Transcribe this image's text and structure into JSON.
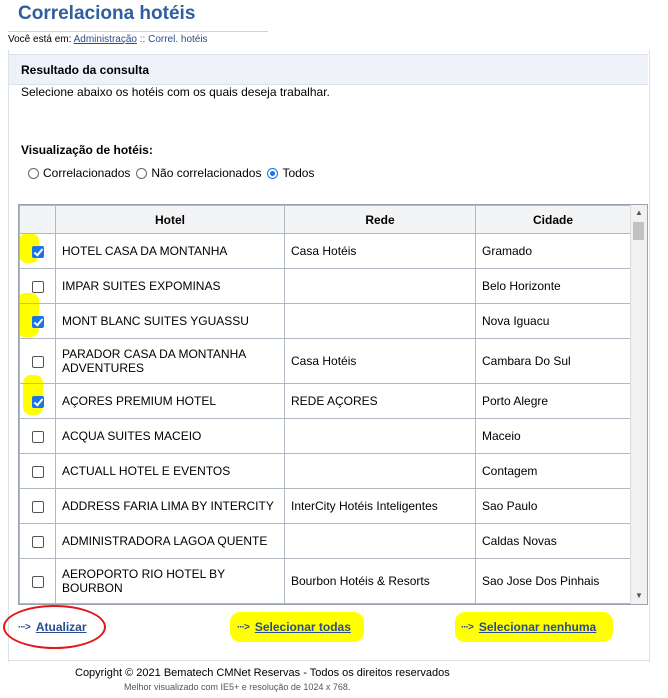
{
  "page": {
    "title": "Correlaciona hotéis",
    "breadcrumb_prefix": "Você está em:",
    "breadcrumb_link": "Administração",
    "breadcrumb_sep": "::",
    "breadcrumb_current": "Correl. hotéis"
  },
  "result": {
    "title": "Resultado da consulta",
    "description": "Selecione abaixo os hotéis com os quais deseja trabalhar."
  },
  "visualization": {
    "label": "Visualização de hotéis:",
    "options": [
      {
        "label": "Correlacionados",
        "selected": false
      },
      {
        "label": "Não correlacionados",
        "selected": false
      },
      {
        "label": "Todos",
        "selected": true
      }
    ]
  },
  "table": {
    "headers": [
      "Hotel",
      "Rede",
      "Cidade"
    ],
    "rows": [
      {
        "checked": true,
        "hotel": "HOTEL CASA DA MONTANHA",
        "rede": "Casa Hotéis",
        "cidade": "Gramado"
      },
      {
        "checked": false,
        "hotel": "IMPAR SUITES EXPOMINAS",
        "rede": "",
        "cidade": "Belo Horizonte"
      },
      {
        "checked": true,
        "hotel": "MONT BLANC SUITES YGUASSU",
        "rede": "",
        "cidade": "Nova Iguacu"
      },
      {
        "checked": false,
        "hotel": "PARADOR CASA DA MONTANHA ADVENTURES",
        "rede": "Casa Hotéis",
        "cidade": "Cambara Do Sul"
      },
      {
        "checked": true,
        "hotel": "AÇORES PREMIUM HOTEL",
        "rede": "REDE AÇORES",
        "cidade": "Porto Alegre"
      },
      {
        "checked": false,
        "hotel": "ACQUA SUITES MACEIO",
        "rede": "",
        "cidade": "Maceio"
      },
      {
        "checked": false,
        "hotel": "ACTUALL HOTEL E EVENTOS",
        "rede": "",
        "cidade": "Contagem"
      },
      {
        "checked": false,
        "hotel": "ADDRESS FARIA LIMA BY INTERCITY",
        "rede": "InterCity Hotéis Inteligentes",
        "cidade": "Sao Paulo"
      },
      {
        "checked": false,
        "hotel": "ADMINISTRADORA LAGOA QUENTE",
        "rede": "",
        "cidade": "Caldas Novas"
      },
      {
        "checked": false,
        "hotel": "AEROPORTO RIO HOTEL BY BOURBON",
        "rede": "Bourbon Hotéis & Resorts",
        "cidade": "Sao Jose Dos Pinhais"
      }
    ]
  },
  "actions": {
    "update": "Atualizar",
    "select_all": "Selecionar todas",
    "select_none": "Selecionar nenhuma"
  },
  "footer": {
    "copyright": "Copyright © 2021 Bematech CMNet Reservas - Todos os direitos reservados",
    "best_view": "Melhor visualizado com IE5+ e resolução de 1024 x 768."
  },
  "colors": {
    "title": "#2f5f9e",
    "link": "#2a4b8d",
    "checkbox_checked": "#1a73e8",
    "highlight": "#ffff00",
    "annotation_circle": "#e01818"
  }
}
